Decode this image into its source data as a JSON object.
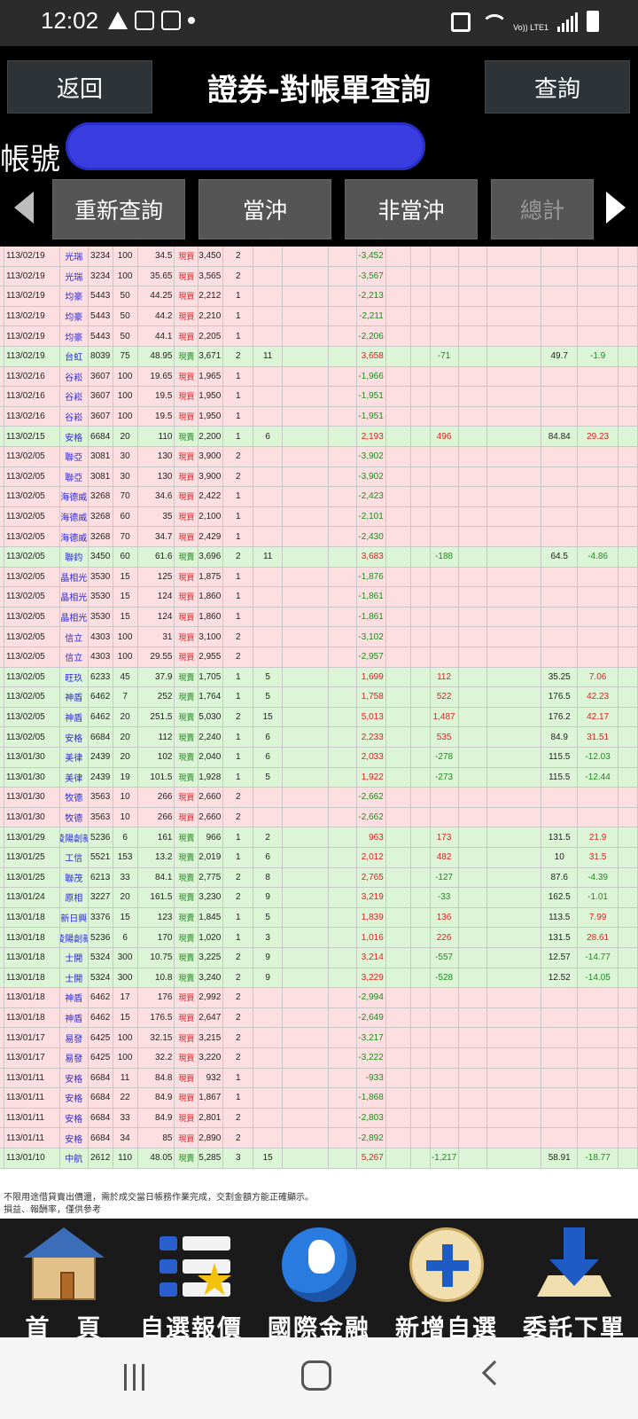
{
  "status_bar": {
    "time": "12:02",
    "volte": "Vo)) LTE1"
  },
  "header": {
    "back_label": "返回",
    "title": "證券-對帳單查詢",
    "query_label": "查詢",
    "account_label": "帳號"
  },
  "tabs": [
    "重新查詢",
    "當沖",
    "非當沖",
    "總計"
  ],
  "rows": [
    [
      "113/02/19",
      "光瑞",
      "3234",
      "100",
      "34.5",
      "現買",
      "3,450",
      "2",
      "",
      "",
      "-3,452",
      "",
      "",
      "",
      ""
    ],
    [
      "113/02/19",
      "光瑞",
      "3234",
      "100",
      "35.65",
      "現買",
      "3,565",
      "2",
      "",
      "",
      "-3,567",
      "",
      "",
      "",
      ""
    ],
    [
      "113/02/19",
      "均豪",
      "5443",
      "50",
      "44.25",
      "現買",
      "2,212",
      "1",
      "",
      "",
      "-2,213",
      "",
      "",
      "",
      ""
    ],
    [
      "113/02/19",
      "均豪",
      "5443",
      "50",
      "44.2",
      "現買",
      "2,210",
      "1",
      "",
      "",
      "-2,211",
      "",
      "",
      "",
      ""
    ],
    [
      "113/02/19",
      "均豪",
      "5443",
      "50",
      "44.1",
      "現買",
      "2,205",
      "1",
      "",
      "",
      "-2,206",
      "",
      "",
      "",
      ""
    ],
    [
      "113/02/19",
      "台虹",
      "8039",
      "75",
      "48.95",
      "現賣",
      "3,671",
      "2",
      "11",
      "",
      "3,658",
      "-71",
      "",
      "49.7",
      "-1.9"
    ],
    [
      "113/02/16",
      "谷崧",
      "3607",
      "100",
      "19.65",
      "現買",
      "1,965",
      "1",
      "",
      "",
      "-1,966",
      "",
      "",
      "",
      ""
    ],
    [
      "113/02/16",
      "谷崧",
      "3607",
      "100",
      "19.5",
      "現買",
      "1,950",
      "1",
      "",
      "",
      "-1,951",
      "",
      "",
      "",
      ""
    ],
    [
      "113/02/16",
      "谷崧",
      "3607",
      "100",
      "19.5",
      "現買",
      "1,950",
      "1",
      "",
      "",
      "-1,951",
      "",
      "",
      "",
      ""
    ],
    [
      "113/02/15",
      "安格",
      "6684",
      "20",
      "110",
      "現賣",
      "2,200",
      "1",
      "6",
      "",
      "2,193",
      "496",
      "",
      "84.84",
      "29.23"
    ],
    [
      "113/02/05",
      "聯亞",
      "3081",
      "30",
      "130",
      "現買",
      "3,900",
      "2",
      "",
      "",
      "-3,902",
      "",
      "",
      "",
      ""
    ],
    [
      "113/02/05",
      "聯亞",
      "3081",
      "30",
      "130",
      "現買",
      "3,900",
      "2",
      "",
      "",
      "-3,902",
      "",
      "",
      "",
      ""
    ],
    [
      "113/02/05",
      "海德威",
      "3268",
      "70",
      "34.6",
      "現買",
      "2,422",
      "1",
      "",
      "",
      "-2,423",
      "",
      "",
      "",
      ""
    ],
    [
      "113/02/05",
      "海德威",
      "3268",
      "60",
      "35",
      "現買",
      "2,100",
      "1",
      "",
      "",
      "-2,101",
      "",
      "",
      "",
      ""
    ],
    [
      "113/02/05",
      "海德威",
      "3268",
      "70",
      "34.7",
      "現買",
      "2,429",
      "1",
      "",
      "",
      "-2,430",
      "",
      "",
      "",
      ""
    ],
    [
      "113/02/05",
      "聯鈞",
      "3450",
      "60",
      "61.6",
      "現賣",
      "3,696",
      "2",
      "11",
      "",
      "3,683",
      "-188",
      "",
      "64.5",
      "-4.86"
    ],
    [
      "113/02/05",
      "晶相光",
      "3530",
      "15",
      "125",
      "現買",
      "1,875",
      "1",
      "",
      "",
      "-1,876",
      "",
      "",
      "",
      ""
    ],
    [
      "113/02/05",
      "晶相光",
      "3530",
      "15",
      "124",
      "現買",
      "1,860",
      "1",
      "",
      "",
      "-1,861",
      "",
      "",
      "",
      ""
    ],
    [
      "113/02/05",
      "晶相光",
      "3530",
      "15",
      "124",
      "現買",
      "1,860",
      "1",
      "",
      "",
      "-1,861",
      "",
      "",
      "",
      ""
    ],
    [
      "113/02/05",
      "信立",
      "4303",
      "100",
      "31",
      "現買",
      "3,100",
      "2",
      "",
      "",
      "-3,102",
      "",
      "",
      "",
      ""
    ],
    [
      "113/02/05",
      "信立",
      "4303",
      "100",
      "29.55",
      "現買",
      "2,955",
      "2",
      "",
      "",
      "-2,957",
      "",
      "",
      "",
      ""
    ],
    [
      "113/02/05",
      "旺玖",
      "6233",
      "45",
      "37.9",
      "現賣",
      "1,705",
      "1",
      "5",
      "",
      "1,699",
      "112",
      "",
      "35.25",
      "7.06"
    ],
    [
      "113/02/05",
      "神盾",
      "6462",
      "7",
      "252",
      "現賣",
      "1,764",
      "1",
      "5",
      "",
      "1,758",
      "522",
      "",
      "176.5",
      "42.23"
    ],
    [
      "113/02/05",
      "神盾",
      "6462",
      "20",
      "251.5",
      "現賣",
      "5,030",
      "2",
      "15",
      "",
      "5,013",
      "1,487",
      "",
      "176.2",
      "42.17"
    ],
    [
      "113/02/05",
      "安格",
      "6684",
      "20",
      "112",
      "現賣",
      "2,240",
      "1",
      "6",
      "",
      "2,233",
      "535",
      "",
      "84.9",
      "31.51"
    ],
    [
      "113/01/30",
      "美律",
      "2439",
      "20",
      "102",
      "現賣",
      "2,040",
      "1",
      "6",
      "",
      "2,033",
      "-278",
      "",
      "115.5",
      "-12.03"
    ],
    [
      "113/01/30",
      "美律",
      "2439",
      "19",
      "101.5",
      "現賣",
      "1,928",
      "1",
      "5",
      "",
      "1,922",
      "-273",
      "",
      "115.5",
      "-12.44"
    ],
    [
      "113/01/30",
      "牧德",
      "3563",
      "10",
      "266",
      "現買",
      "2,660",
      "2",
      "",
      "",
      "-2,662",
      "",
      "",
      "",
      ""
    ],
    [
      "113/01/30",
      "牧德",
      "3563",
      "10",
      "266",
      "現買",
      "2,660",
      "2",
      "",
      "",
      "-2,662",
      "",
      "",
      "",
      ""
    ],
    [
      "113/01/29",
      "凌陽創新",
      "5236",
      "6",
      "161",
      "現賣",
      "966",
      "1",
      "2",
      "",
      "963",
      "173",
      "",
      "131.5",
      "21.9"
    ],
    [
      "113/01/25",
      "工信",
      "5521",
      "153",
      "13.2",
      "現賣",
      "2,019",
      "1",
      "6",
      "",
      "2,012",
      "482",
      "",
      "10",
      "31.5"
    ],
    [
      "113/01/25",
      "聯茂",
      "6213",
      "33",
      "84.1",
      "現賣",
      "2,775",
      "2",
      "8",
      "",
      "2,765",
      "-127",
      "",
      "87.6",
      "-4.39"
    ],
    [
      "113/01/24",
      "原相",
      "3227",
      "20",
      "161.5",
      "現賣",
      "3,230",
      "2",
      "9",
      "",
      "3,219",
      "-33",
      "",
      "162.5",
      "-1.01"
    ],
    [
      "113/01/18",
      "新日興",
      "3376",
      "15",
      "123",
      "現賣",
      "1,845",
      "1",
      "5",
      "",
      "1,839",
      "136",
      "",
      "113.5",
      "7.99"
    ],
    [
      "113/01/18",
      "凌陽創新",
      "5236",
      "6",
      "170",
      "現賣",
      "1,020",
      "1",
      "3",
      "",
      "1,016",
      "226",
      "",
      "131.5",
      "28.61"
    ],
    [
      "113/01/18",
      "士開",
      "5324",
      "300",
      "10.75",
      "現賣",
      "3,225",
      "2",
      "9",
      "",
      "3,214",
      "-557",
      "",
      "12.57",
      "-14.77"
    ],
    [
      "113/01/18",
      "士開",
      "5324",
      "300",
      "10.8",
      "現賣",
      "3,240",
      "2",
      "9",
      "",
      "3,229",
      "-528",
      "",
      "12.52",
      "-14.05"
    ],
    [
      "113/01/18",
      "神盾",
      "6462",
      "17",
      "176",
      "現買",
      "2,992",
      "2",
      "",
      "",
      "-2,994",
      "",
      "",
      "",
      ""
    ],
    [
      "113/01/18",
      "神盾",
      "6462",
      "15",
      "176.5",
      "現買",
      "2,647",
      "2",
      "",
      "",
      "-2,649",
      "",
      "",
      "",
      ""
    ],
    [
      "113/01/17",
      "易發",
      "6425",
      "100",
      "32.15",
      "現買",
      "3,215",
      "2",
      "",
      "",
      "-3,217",
      "",
      "",
      "",
      ""
    ],
    [
      "113/01/17",
      "易發",
      "6425",
      "100",
      "32.2",
      "現買",
      "3,220",
      "2",
      "",
      "",
      "-3,222",
      "",
      "",
      "",
      ""
    ],
    [
      "113/01/11",
      "安格",
      "6684",
      "11",
      "84.8",
      "現買",
      "932",
      "1",
      "",
      "",
      "-933",
      "",
      "",
      "",
      ""
    ],
    [
      "113/01/11",
      "安格",
      "6684",
      "22",
      "84.9",
      "現買",
      "1,867",
      "1",
      "",
      "",
      "-1,868",
      "",
      "",
      "",
      ""
    ],
    [
      "113/01/11",
      "安格",
      "6684",
      "33",
      "84.9",
      "現買",
      "2,801",
      "2",
      "",
      "",
      "-2,803",
      "",
      "",
      "",
      ""
    ],
    [
      "113/01/11",
      "安格",
      "6684",
      "34",
      "85",
      "現買",
      "2,890",
      "2",
      "",
      "",
      "-2,892",
      "",
      "",
      "",
      ""
    ],
    [
      "113/01/10",
      "中航",
      "2612",
      "110",
      "48.05",
      "現賣",
      "5,285",
      "3",
      "15",
      "",
      "5,267",
      "-1,217",
      "",
      "58.91",
      "-18.77"
    ]
  ],
  "notes": [
    "不限用途借貸賣出價還，需於成交當日帳務作業完成，交割金額方能正確顯示。",
    "損益、報酬率，僅供參考"
  ],
  "bottom_nav": [
    "首　頁",
    "自選報價",
    "國際金融",
    "新增自選",
    "委託下單"
  ],
  "colors": {
    "buy_row": "#fddfe1",
    "sell_row": "#dcf5d6",
    "positive": "#e02020",
    "negative": "#1d8a1d",
    "stock_name": "#2a2ad8"
  }
}
